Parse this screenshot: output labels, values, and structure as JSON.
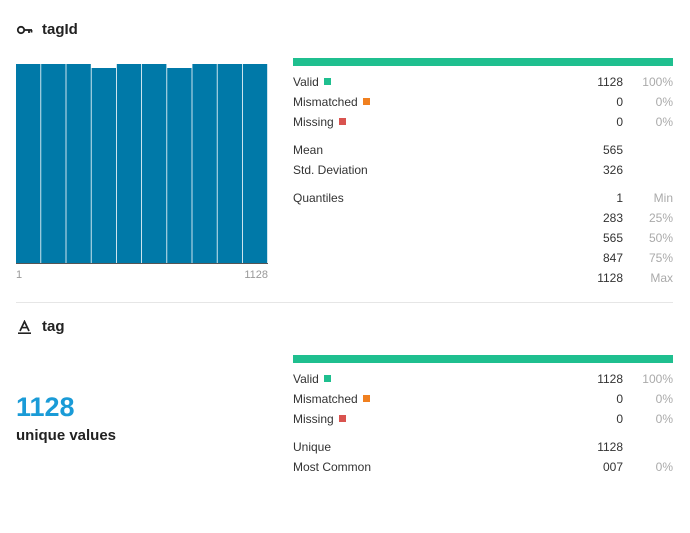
{
  "colors": {
    "accent": "#1fbf8f",
    "hist_bar": "#0079a8",
    "mismatched": "#f08020",
    "missing": "#d9534f",
    "unique_value": "#1a9bd7"
  },
  "tagId": {
    "title": "tagId",
    "icon": "key-icon",
    "histogram": {
      "type": "bar",
      "values": [
        1.0,
        1.0,
        1.0,
        0.98,
        1.0,
        1.0,
        0.98,
        1.0,
        1.0,
        1.0
      ],
      "x_min_label": "1",
      "x_max_label": "1128"
    },
    "valid": {
      "label": "Valid",
      "value": "1128",
      "pct": "100%"
    },
    "mismatched": {
      "label": "Mismatched",
      "value": "0",
      "pct": "0%"
    },
    "missing": {
      "label": "Missing",
      "value": "0",
      "pct": "0%"
    },
    "mean": {
      "label": "Mean",
      "value": "565"
    },
    "std": {
      "label": "Std. Deviation",
      "value": "326"
    },
    "quantiles": {
      "label": "Quantiles",
      "rows": [
        {
          "value": "1",
          "tag": "Min"
        },
        {
          "value": "283",
          "tag": "25%"
        },
        {
          "value": "565",
          "tag": "50%"
        },
        {
          "value": "847",
          "tag": "75%"
        },
        {
          "value": "1128",
          "tag": "Max"
        }
      ]
    }
  },
  "tag": {
    "title": "tag",
    "icon": "text-type-icon",
    "unique_count": "1128",
    "unique_label": "unique values",
    "valid": {
      "label": "Valid",
      "value": "1128",
      "pct": "100%"
    },
    "mismatched": {
      "label": "Mismatched",
      "value": "0",
      "pct": "0%"
    },
    "missing": {
      "label": "Missing",
      "value": "0",
      "pct": "0%"
    },
    "unique": {
      "label": "Unique",
      "value": "1128"
    },
    "most_common": {
      "label": "Most Common",
      "value": "007",
      "pct": "0%"
    }
  }
}
